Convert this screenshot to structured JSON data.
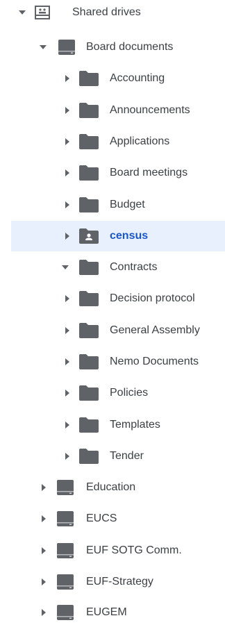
{
  "tree": {
    "root": {
      "label": "Shared drives",
      "expanded": true,
      "icon": "shared-drives-icon"
    },
    "drive": {
      "label": "Board documents",
      "expanded": true,
      "icon": "drive-icon"
    },
    "folders": [
      {
        "label": "Accounting",
        "expanded": false,
        "icon": "folder-icon"
      },
      {
        "label": "Announcements",
        "expanded": false,
        "icon": "folder-icon"
      },
      {
        "label": "Applications",
        "expanded": false,
        "icon": "folder-icon"
      },
      {
        "label": "Board meetings",
        "expanded": false,
        "icon": "folder-icon"
      },
      {
        "label": "Budget",
        "expanded": false,
        "icon": "folder-icon"
      },
      {
        "label": "census",
        "expanded": false,
        "icon": "shared-folder-icon",
        "selected": true
      },
      {
        "label": "Contracts",
        "expanded": true,
        "icon": "folder-icon"
      },
      {
        "label": "Decision protocol",
        "expanded": false,
        "icon": "folder-icon"
      },
      {
        "label": "General Assembly",
        "expanded": false,
        "icon": "folder-icon"
      },
      {
        "label": "Nemo Documents",
        "expanded": false,
        "icon": "folder-icon"
      },
      {
        "label": "Policies",
        "expanded": false,
        "icon": "folder-icon"
      },
      {
        "label": "Templates",
        "expanded": false,
        "icon": "folder-icon"
      },
      {
        "label": "Tender",
        "expanded": false,
        "icon": "folder-icon"
      }
    ],
    "other_drives": [
      {
        "label": "Education",
        "expanded": false,
        "icon": "drive-icon"
      },
      {
        "label": "EUCS",
        "expanded": false,
        "icon": "drive-icon"
      },
      {
        "label": "EUF SOTG Comm.",
        "expanded": false,
        "icon": "drive-icon"
      },
      {
        "label": "EUF-Strategy",
        "expanded": false,
        "icon": "drive-icon"
      },
      {
        "label": "EUGEM",
        "expanded": false,
        "icon": "drive-icon"
      }
    ]
  },
  "colors": {
    "icon_gray": "#5f6368",
    "selected_bg": "#e8f0fe",
    "selected_text": "#1a56c8"
  }
}
